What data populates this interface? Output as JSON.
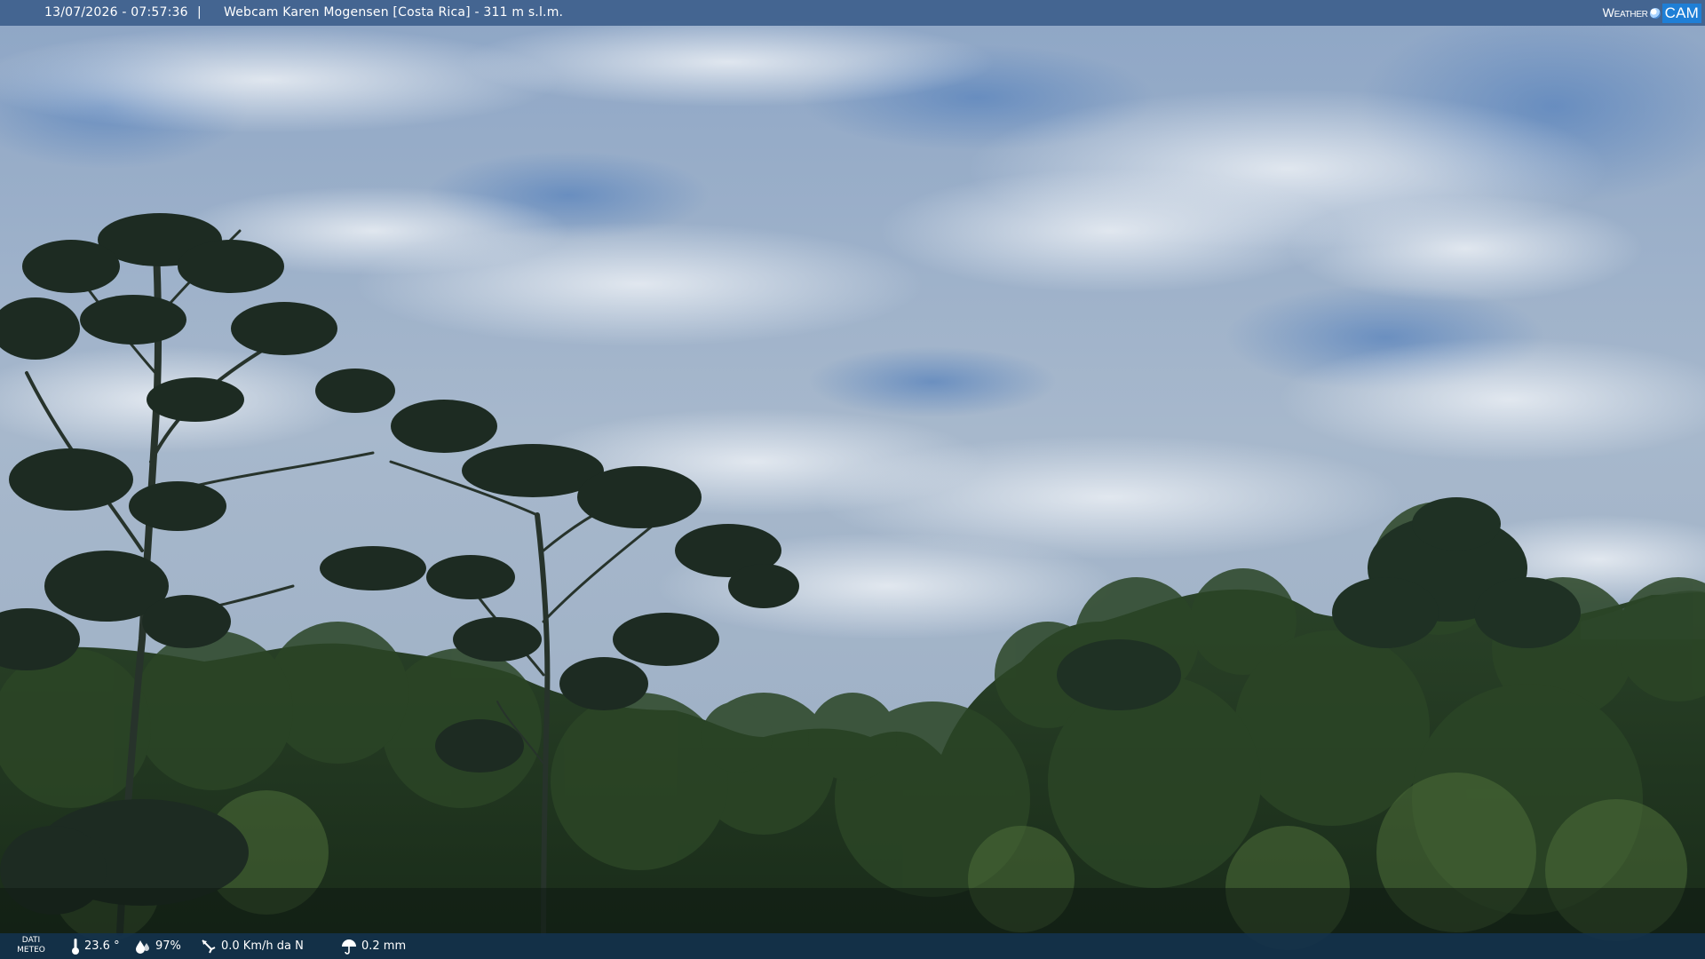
{
  "top_bar": {
    "timestamp": "13/07/2026 - 07:57:36",
    "separator": "|",
    "title": "Webcam Karen Mogensen [Costa Rica]  - 311 m s.l.m."
  },
  "brand": {
    "weather_text": "Weather",
    "cam_text": "CAM"
  },
  "bottom_bar": {
    "label_line1": "DATI",
    "label_line2": "METEO",
    "temperature": "23.6 °",
    "humidity": "97%",
    "wind": "0.0 Km/h da N",
    "rain": "0.2 mm"
  },
  "colors": {
    "sky_top": "#7f9bc0",
    "sky_bottom": "#b6c4d4",
    "forest_dark": "#142316",
    "forest_mid": "#243b22",
    "tree_silhouette": "#1b2a20"
  }
}
